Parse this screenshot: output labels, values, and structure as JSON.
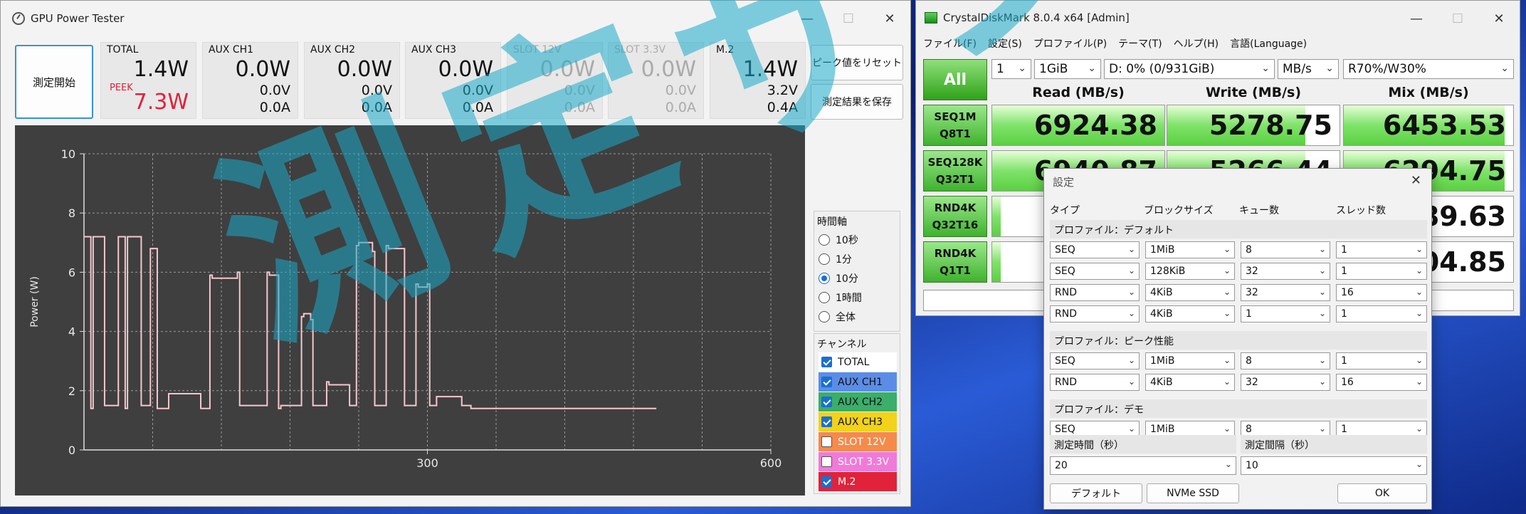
{
  "gpu": {
    "title": "GPU Power Tester",
    "start_label": "測定開始",
    "reset_peak_label": "ピーク値をリセット",
    "save_label": "測定結果を保存",
    "peek_label": "PEEK",
    "meters": [
      {
        "label": "TOTAL",
        "power": "1.4W",
        "peak": "7.3W",
        "enabled": true
      },
      {
        "label": "AUX CH1",
        "power": "0.0W",
        "voltage": "0.0V",
        "current": "0.0A",
        "enabled": true
      },
      {
        "label": "AUX CH2",
        "power": "0.0W",
        "voltage": "0.0V",
        "current": "0.0A",
        "enabled": true
      },
      {
        "label": "AUX CH3",
        "power": "0.0W",
        "voltage": "0.0V",
        "current": "0.0A",
        "enabled": true
      },
      {
        "label": "SLOT 12V",
        "power": "0.0W",
        "voltage": "0.0V",
        "current": "0.0A",
        "enabled": false
      },
      {
        "label": "SLOT 3.3V",
        "power": "0.0W",
        "voltage": "0.0V",
        "current": "0.0A",
        "enabled": false
      },
      {
        "label": "M.2",
        "power": "1.4W",
        "voltage": "3.2V",
        "current": "0.4A",
        "enabled": true
      }
    ],
    "time_axis": {
      "title": "時間軸",
      "options": [
        "10秒",
        "1分",
        "10分",
        "1時間",
        "全体"
      ],
      "selected": "10分"
    },
    "channels": {
      "title": "チャンネル",
      "items": [
        {
          "label": "TOTAL",
          "checked": true,
          "bg": "#ffffff",
          "fg": "#111111"
        },
        {
          "label": "AUX CH1",
          "checked": true,
          "bg": "#5b8de8",
          "fg": "#111111"
        },
        {
          "label": "AUX CH2",
          "checked": true,
          "bg": "#3aae6a",
          "fg": "#111111"
        },
        {
          "label": "AUX CH3",
          "checked": true,
          "bg": "#f2d21a",
          "fg": "#111111"
        },
        {
          "label": "SLOT 12V",
          "checked": false,
          "bg": "#f58a4a",
          "fg": "#ffffff"
        },
        {
          "label": "SLOT 3.3V",
          "checked": false,
          "bg": "#f07ad8",
          "fg": "#ffffff"
        },
        {
          "label": "M.2",
          "checked": true,
          "bg": "#e0223a",
          "fg": "#ffffff"
        }
      ]
    }
  },
  "chart_data": {
    "type": "line",
    "title": "",
    "xlabel": "",
    "ylabel": "Power (W)",
    "xlim": [
      0,
      600
    ],
    "ylim": [
      0,
      10
    ],
    "x_ticks": [
      "300",
      "600"
    ],
    "y_ticks": [
      "0",
      "2",
      "4",
      "6",
      "8",
      "10"
    ],
    "grid": true,
    "series": [
      {
        "color": "#f7c6cf",
        "x": [
          0,
          4,
          6,
          8,
          16,
          18,
          28,
          30,
          34,
          36,
          38,
          48,
          50,
          56,
          58,
          62,
          64,
          72,
          74,
          100,
          102,
          108,
          110,
          112,
          134,
          136,
          144,
          146,
          160,
          162,
          168,
          170,
          172,
          190,
          192,
          198,
          200,
          210,
          212,
          214,
          230,
          232,
          236,
          238,
          240,
          252,
          254,
          262,
          264,
          266,
          278,
          280,
          288,
          290,
          292,
          300,
          302,
          306,
          308,
          310,
          328,
          330,
          336,
          338,
          340,
          348,
          350,
          358,
          360,
          362,
          382,
          384,
          392,
          394,
          396,
          412,
          414,
          420,
          422,
          424,
          450,
          452,
          460,
          462,
          490,
          492,
          500
        ],
        "y": [
          7.2,
          7.2,
          1.4,
          7.2,
          7.2,
          1.5,
          1.5,
          7.2,
          7.2,
          1.4,
          7.2,
          7.2,
          1.5,
          1.5,
          6.8,
          6.8,
          1.4,
          1.4,
          1.9,
          1.9,
          1.4,
          1.4,
          5.9,
          5.8,
          6.0,
          1.5,
          1.5,
          1.5,
          6.0,
          5.9,
          5.9,
          1.4,
          1.5,
          4.5,
          4.6,
          4.4,
          1.5,
          1.5,
          2.3,
          2.2,
          2.2,
          1.5,
          1.5,
          6.9,
          7.0,
          6.7,
          1.5,
          1.5,
          6.9,
          6.8,
          6.8,
          1.5,
          1.5,
          5.6,
          5.5,
          5.6,
          1.5,
          1.5,
          1.8,
          1.8,
          1.8,
          1.5,
          1.5,
          1.4,
          1.4,
          1.4,
          1.4,
          1.4,
          1.4,
          1.4,
          1.4,
          1.4,
          1.4,
          1.4,
          1.4,
          1.4,
          1.4,
          1.4,
          1.4,
          1.4,
          1.4,
          1.4,
          1.4,
          1.4,
          1.4,
          1.4,
          1.4
        ]
      }
    ]
  },
  "cdm": {
    "title": "CrystalDiskMark 8.0.4 x64 [Admin]",
    "menu": [
      "ファイル(F)",
      "設定(S)",
      "プロファイル(P)",
      "テーマ(T)",
      "ヘルプ(H)",
      "言語(Language)"
    ],
    "all_label": "All",
    "count": "1",
    "size": "1GiB",
    "drive": "D: 0% (0/931GiB)",
    "unit": "MB/s",
    "mix": "R70%/W30%",
    "headers": [
      "Read (MB/s)",
      "Write (MB/s)",
      "Mix (MB/s)"
    ],
    "rows": [
      {
        "line1": "SEQ1M",
        "line2": "Q8T1",
        "read": "6924.38",
        "write": "5278.75",
        "mix": "6453.53"
      },
      {
        "line1": "SEQ128K",
        "line2": "Q32T1",
        "read": "6940.87",
        "write": "5266.44",
        "mix": "6294.75"
      },
      {
        "line1": "RND4K",
        "line2": "Q32T16",
        "read": "",
        "write": "",
        "mix": "89.63"
      },
      {
        "line1": "RND4K",
        "line2": "Q1T1",
        "read": "",
        "write": "",
        "mix": "04.85"
      }
    ],
    "read_fill": [
      1.0,
      1.0,
      0.05,
      0.05
    ],
    "write_fill": [
      0.8,
      0.8,
      0.05,
      0.05
    ],
    "mix_fill": [
      0.95,
      0.95,
      0.05,
      0.05
    ]
  },
  "settings": {
    "title": "設定",
    "close": "✕",
    "col_headers": [
      "タイプ",
      "ブロックサイズ",
      "キュー数",
      "スレッド数"
    ],
    "sections": [
      {
        "title": "プロファイル：デフォルト",
        "rows": [
          {
            "type": "SEQ",
            "block": "1MiB",
            "queue": "8",
            "threads": "1"
          },
          {
            "type": "SEQ",
            "block": "128KiB",
            "queue": "32",
            "threads": "1"
          },
          {
            "type": "RND",
            "block": "4KiB",
            "queue": "32",
            "threads": "16"
          },
          {
            "type": "RND",
            "block": "4KiB",
            "queue": "1",
            "threads": "1"
          }
        ]
      },
      {
        "title": "プロファイル：ピーク性能",
        "rows": [
          {
            "type": "SEQ",
            "block": "1MiB",
            "queue": "8",
            "threads": "1"
          },
          {
            "type": "RND",
            "block": "4KiB",
            "queue": "32",
            "threads": "16"
          }
        ]
      },
      {
        "title": "プロファイル：デモ",
        "rows": [
          {
            "type": "SEQ",
            "block": "1MiB",
            "queue": "8",
            "threads": "1"
          }
        ]
      }
    ],
    "duration_label": "測定時間（秒）",
    "duration_value": "20",
    "interval_label": "測定間隔（秒）",
    "interval_value": "10",
    "default_btn": "デフォルト",
    "nvme_btn": "NVMe SSD",
    "ok_btn": "OK"
  },
  "watermark": "測定サンプル"
}
